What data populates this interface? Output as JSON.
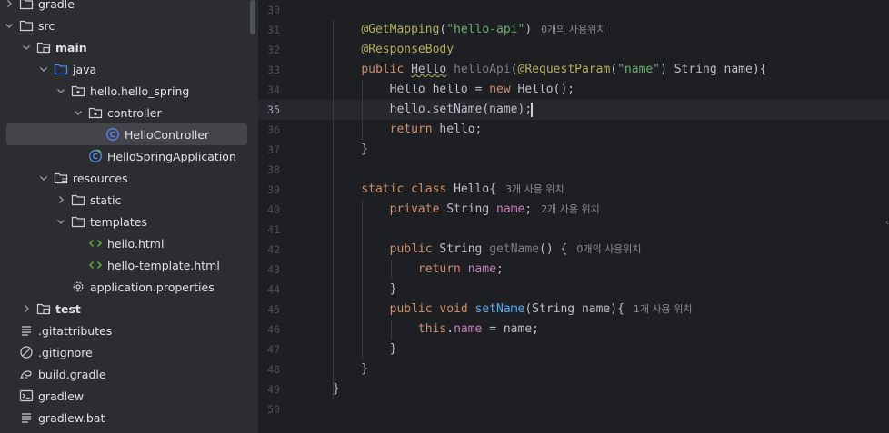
{
  "tree": [
    {
      "label": "gradle",
      "indent": 0,
      "chevron": "right",
      "icon": "folder",
      "bold": false
    },
    {
      "label": "src",
      "indent": 0,
      "chevron": "down",
      "icon": "folder",
      "bold": false
    },
    {
      "label": "main",
      "indent": 1,
      "chevron": "down",
      "icon": "source-folder",
      "bold": true
    },
    {
      "label": "java",
      "indent": 2,
      "chevron": "down",
      "icon": "java-folder",
      "bold": false
    },
    {
      "label": "hello.hello_spring",
      "indent": 3,
      "chevron": "down",
      "icon": "package",
      "bold": false
    },
    {
      "label": "controller",
      "indent": 4,
      "chevron": "down",
      "icon": "package",
      "bold": false
    },
    {
      "label": "HelloController",
      "indent": 5,
      "chevron": "none",
      "icon": "class",
      "bold": false,
      "selected": true
    },
    {
      "label": "HelloSpringApplication",
      "indent": 4,
      "chevron": "none",
      "icon": "spring-class",
      "bold": false
    },
    {
      "label": "resources",
      "indent": 2,
      "chevron": "down",
      "icon": "resources-folder",
      "bold": false
    },
    {
      "label": "static",
      "indent": 3,
      "chevron": "right",
      "icon": "folder",
      "bold": false
    },
    {
      "label": "templates",
      "indent": 3,
      "chevron": "down",
      "icon": "folder",
      "bold": false
    },
    {
      "label": "hello.html",
      "indent": 4,
      "chevron": "none",
      "icon": "html",
      "bold": false
    },
    {
      "label": "hello-template.html",
      "indent": 4,
      "chevron": "none",
      "icon": "html",
      "bold": false
    },
    {
      "label": "application.properties",
      "indent": 3,
      "chevron": "none",
      "icon": "settings",
      "bold": false
    },
    {
      "label": "test",
      "indent": 1,
      "chevron": "right",
      "icon": "source-folder",
      "bold": true
    },
    {
      "label": ".gitattributes",
      "indent": 0,
      "chevron": "none",
      "icon": "text-file",
      "bold": false
    },
    {
      "label": ".gitignore",
      "indent": 0,
      "chevron": "none",
      "icon": "ignore-file",
      "bold": false
    },
    {
      "label": "build.gradle",
      "indent": 0,
      "chevron": "none",
      "icon": "gradle-file",
      "bold": false
    },
    {
      "label": "gradlew",
      "indent": 0,
      "chevron": "none",
      "icon": "terminal-file",
      "bold": false
    },
    {
      "label": "gradlew.bat",
      "indent": 0,
      "chevron": "none",
      "icon": "text-file",
      "bold": false
    }
  ],
  "editor": {
    "current_line": 35,
    "lines": [
      {
        "n": 30,
        "tokens": []
      },
      {
        "n": 31,
        "tokens": [
          {
            "t": "    "
          },
          {
            "t": "@GetMapping",
            "c": "ann"
          },
          {
            "t": "("
          },
          {
            "t": "\"hello-api\"",
            "c": "str"
          },
          {
            "t": ")"
          },
          {
            "t": "0개의 사용위치",
            "c": "hint"
          }
        ]
      },
      {
        "n": 32,
        "tokens": [
          {
            "t": "    "
          },
          {
            "t": "@ResponseBody",
            "c": "ann"
          }
        ]
      },
      {
        "n": 33,
        "tokens": [
          {
            "t": "    "
          },
          {
            "t": "public ",
            "c": "kw"
          },
          {
            "t": "Hello",
            "c": "wavy"
          },
          {
            "t": " "
          },
          {
            "t": "helloApi",
            "c": "dim"
          },
          {
            "t": "("
          },
          {
            "t": "@RequestParam",
            "c": "ann"
          },
          {
            "t": "("
          },
          {
            "t": "\"name\"",
            "c": "str"
          },
          {
            "t": ") String name){"
          }
        ]
      },
      {
        "n": 34,
        "tokens": [
          {
            "t": "        Hello hello = "
          },
          {
            "t": "new ",
            "c": "kw"
          },
          {
            "t": "Hello();"
          }
        ]
      },
      {
        "n": 35,
        "tokens": [
          {
            "t": "        hello.setName(name);"
          },
          {
            "t": "",
            "c": "caret"
          }
        ]
      },
      {
        "n": 36,
        "tokens": [
          {
            "t": "        "
          },
          {
            "t": "return ",
            "c": "kw"
          },
          {
            "t": "hello;"
          }
        ]
      },
      {
        "n": 37,
        "tokens": [
          {
            "t": "    }"
          }
        ]
      },
      {
        "n": 38,
        "tokens": []
      },
      {
        "n": 39,
        "tokens": [
          {
            "t": "    "
          },
          {
            "t": "static class ",
            "c": "kw"
          },
          {
            "t": "Hello{"
          },
          {
            "t": "3개 사용 위치",
            "c": "hint"
          }
        ]
      },
      {
        "n": 40,
        "tokens": [
          {
            "t": "        "
          },
          {
            "t": "private ",
            "c": "kw"
          },
          {
            "t": "String "
          },
          {
            "t": "name",
            "c": "fld"
          },
          {
            "t": ";"
          },
          {
            "t": "2개 사용 위치",
            "c": "hint"
          }
        ]
      },
      {
        "n": 41,
        "tokens": []
      },
      {
        "n": 42,
        "tokens": [
          {
            "t": "        "
          },
          {
            "t": "public ",
            "c": "kw"
          },
          {
            "t": "String "
          },
          {
            "t": "getName",
            "c": "dim"
          },
          {
            "t": "() {"
          },
          {
            "t": "0개의 사용위치",
            "c": "hint"
          }
        ]
      },
      {
        "n": 43,
        "tokens": [
          {
            "t": "            "
          },
          {
            "t": "return ",
            "c": "kw"
          },
          {
            "t": "name",
            "c": "fld"
          },
          {
            "t": ";"
          }
        ]
      },
      {
        "n": 44,
        "tokens": [
          {
            "t": "        }"
          }
        ]
      },
      {
        "n": 45,
        "tokens": [
          {
            "t": "        "
          },
          {
            "t": "public void ",
            "c": "kw"
          },
          {
            "t": "setName",
            "c": "fn"
          },
          {
            "t": "(String name){"
          },
          {
            "t": "1개 사용 위치",
            "c": "hint"
          }
        ]
      },
      {
        "n": 46,
        "tokens": [
          {
            "t": "            "
          },
          {
            "t": "this",
            "c": "kw"
          },
          {
            "t": "."
          },
          {
            "t": "name",
            "c": "fld"
          },
          {
            "t": " = name;"
          }
        ]
      },
      {
        "n": 47,
        "tokens": [
          {
            "t": "        }"
          }
        ]
      },
      {
        "n": 48,
        "tokens": [
          {
            "t": "    }"
          }
        ]
      },
      {
        "n": 49,
        "tokens": [
          {
            "t": "}"
          }
        ]
      },
      {
        "n": 50,
        "tokens": []
      }
    ]
  }
}
